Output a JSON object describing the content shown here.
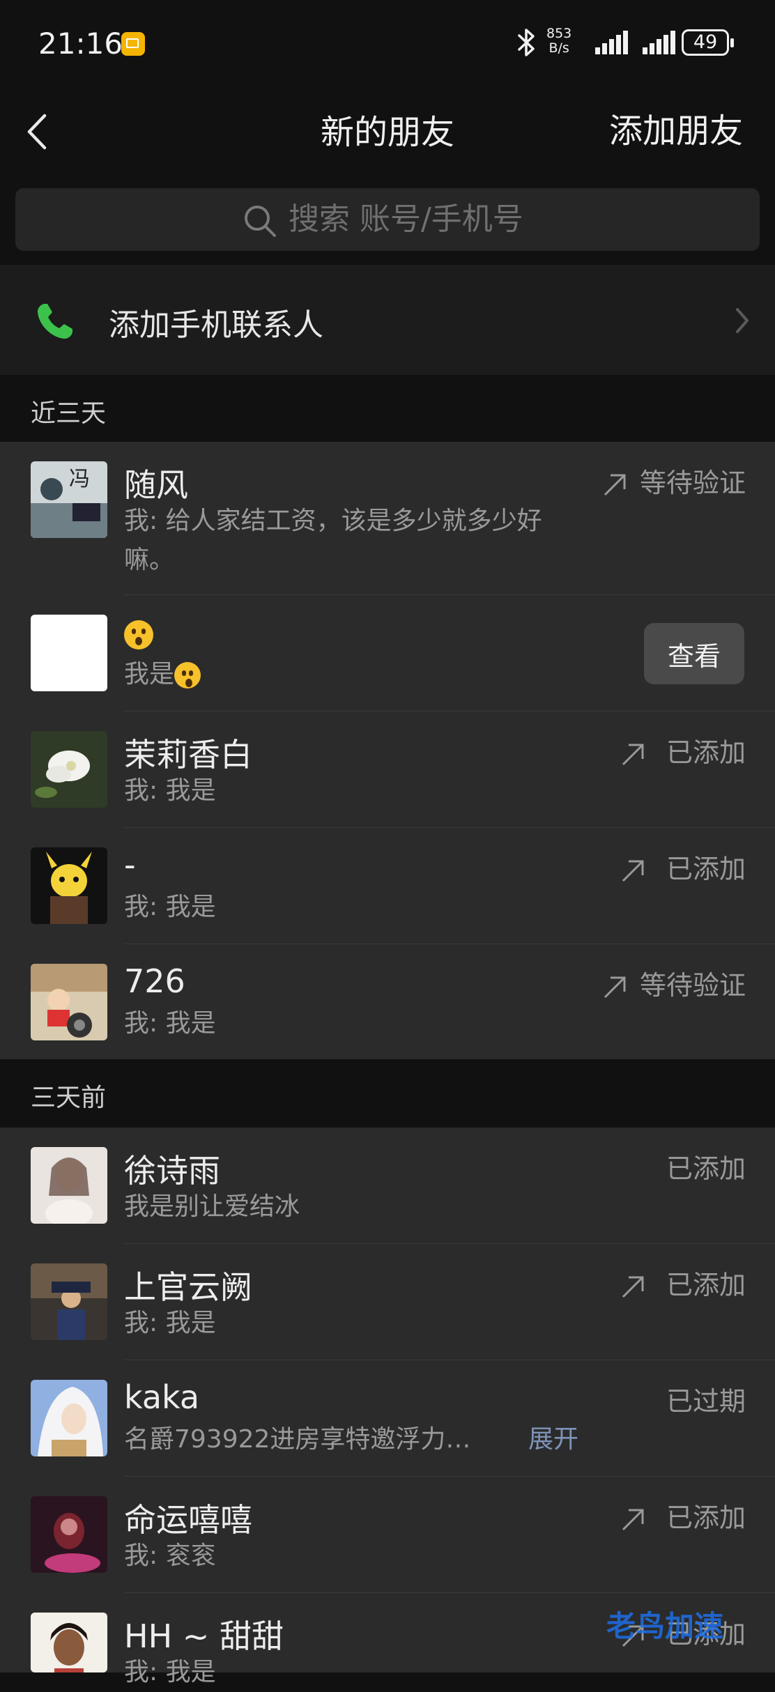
{
  "status_bar": {
    "time": "21:16",
    "net_speed_value": "853",
    "net_speed_unit": "B/s",
    "battery": "49"
  },
  "nav": {
    "title": "新的朋友",
    "action": "添加朋友"
  },
  "search": {
    "placeholder": "搜索 账号/手机号"
  },
  "add_phone": {
    "label": "添加手机联系人"
  },
  "sections": [
    {
      "title": "近三天",
      "items": [
        {
          "name": "随风",
          "message": "我: 给人家结工资，该是多少就多少好嘛。",
          "status": "等待验证",
          "arrow": true
        },
        {
          "name_emoji": "astonished",
          "message": "我是",
          "message_emoji": "astonished",
          "button": "查看"
        },
        {
          "name": "茉莉香白",
          "message": "我: 我是",
          "status": "已添加",
          "arrow": true
        },
        {
          "name": "-",
          "message": "我: 我是",
          "status": "已添加",
          "arrow": true
        },
        {
          "name": "726",
          "message": "我: 我是",
          "status": "等待验证",
          "arrow": true
        }
      ]
    },
    {
      "title": "三天前",
      "items": [
        {
          "name": "徐诗雨",
          "message": "我是别让爱结冰",
          "status": "已添加",
          "arrow": false
        },
        {
          "name": "上官云阙",
          "message": "我: 我是",
          "status": "已添加",
          "arrow": true
        },
        {
          "name": "kaka",
          "message": "名爵793922进房享特邀浮力…",
          "status": "已过期",
          "arrow": false,
          "expand": "展开"
        },
        {
          "name": "命运嘻嘻",
          "message": "我: 衮衮",
          "status": "已添加",
          "arrow": true
        },
        {
          "name": "HH ~ 甜甜",
          "message": "我: 我是",
          "status": "已添加",
          "arrow": true
        }
      ]
    }
  ],
  "watermark": "老鸟加速",
  "colors": {
    "background": "#111111",
    "list_bg": "#2b2b2b",
    "phone_icon": "#3cc24b",
    "link": "#7d93b8"
  }
}
